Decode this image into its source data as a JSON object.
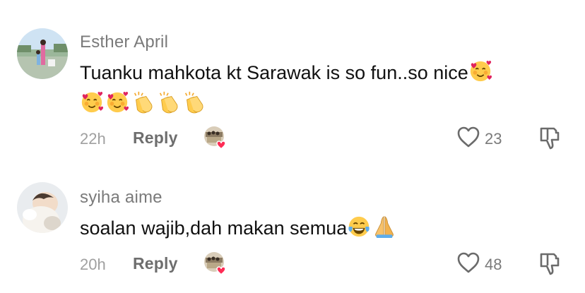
{
  "comments": [
    {
      "username": "Esther April",
      "text_line1": "Tuanku mahkota kt Sarawak is so fun..so nice",
      "time": "22h",
      "reply_label": "Reply",
      "likes": "23",
      "emojis_line1": [
        "smiling-face-with-hearts"
      ],
      "emojis_line2": [
        "smiling-face-with-hearts",
        "smiling-face-with-hearts",
        "clapping-hands",
        "clapping-hands",
        "clapping-hands"
      ]
    },
    {
      "username": "syiha aime",
      "text_line1": "soalan wajib,dah makan semua",
      "time": "20h",
      "reply_label": "Reply",
      "likes": "48",
      "emojis_line1": [
        "face-with-tears-of-joy",
        "folded-hands"
      ]
    }
  ],
  "icons": {
    "like": "heart-outline-icon",
    "dislike": "thumbs-down-outline-icon",
    "creator_liked": "creator-liked-heart-badge"
  },
  "colors": {
    "username": "#7a7a7a",
    "text": "#111111",
    "meta": "#a0a0a0",
    "heart_badge": "#fe2c55"
  }
}
